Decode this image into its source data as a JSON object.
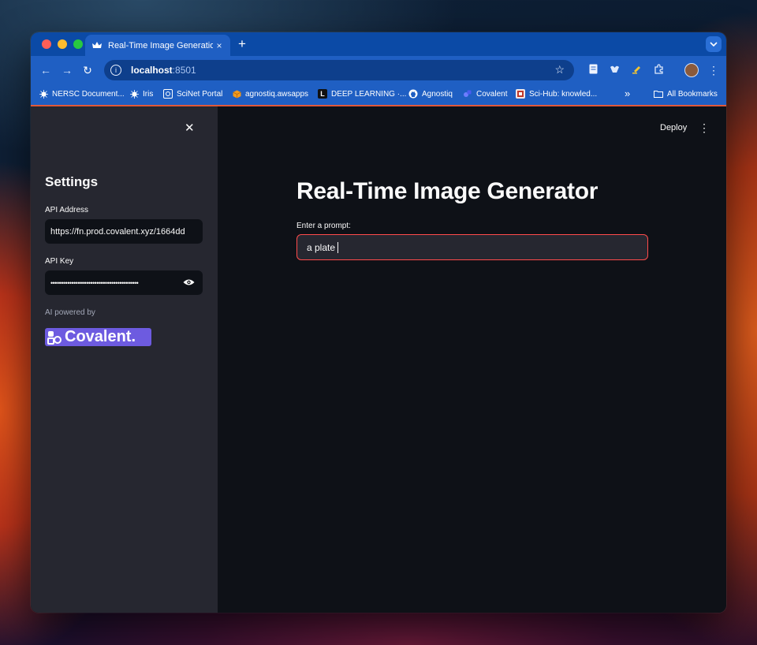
{
  "browser": {
    "tab": {
      "title": "Real-Time Image Generation",
      "close": "×"
    },
    "new_tab": "+",
    "tab_menu": "⌄",
    "nav": {
      "back": "←",
      "forward": "→",
      "reload": "↻"
    },
    "url": {
      "host": "localhost",
      "port": ":8501"
    },
    "bookmarks": [
      {
        "label": "NERSC Document...",
        "icon": "nersc-icon"
      },
      {
        "label": "Iris",
        "icon": "nersc-icon"
      },
      {
        "label": "SciNet Portal",
        "icon": "scinet-icon"
      },
      {
        "label": "agnostiq.awsapps",
        "icon": "aws-cube-icon"
      },
      {
        "label": "DEEP LEARNING ·...",
        "icon": "letter-l-icon"
      },
      {
        "label": "Agnostiq",
        "icon": "github-icon"
      },
      {
        "label": "Covalent",
        "icon": "covalent-icon"
      },
      {
        "label": "Sci-Hub: knowled...",
        "icon": "scihub-icon"
      }
    ],
    "bookmarks_overflow": "»",
    "all_bookmarks": "All Bookmarks"
  },
  "sidebar": {
    "close": "✕",
    "title": "Settings",
    "api_address": {
      "label": "API Address",
      "value": "https://fn.prod.covalent.xyz/1664dd"
    },
    "api_key": {
      "label": "API Key",
      "value": "••••••••••••••••••••••••••••••••••••••••••"
    },
    "powered_by": "AI powered by",
    "logo_text": "Covalent"
  },
  "main": {
    "deploy": "Deploy",
    "menu": "⋮",
    "title": "Real-Time Image Generator",
    "prompt": {
      "label": "Enter a prompt:",
      "value": "a plate"
    }
  },
  "colors": {
    "accent": "#ff4b4b",
    "sidebar_bg": "#262730",
    "app_bg": "#0e1117",
    "browser_blue": "#1f5fc3",
    "covalent_purple": "#6d5be0"
  }
}
